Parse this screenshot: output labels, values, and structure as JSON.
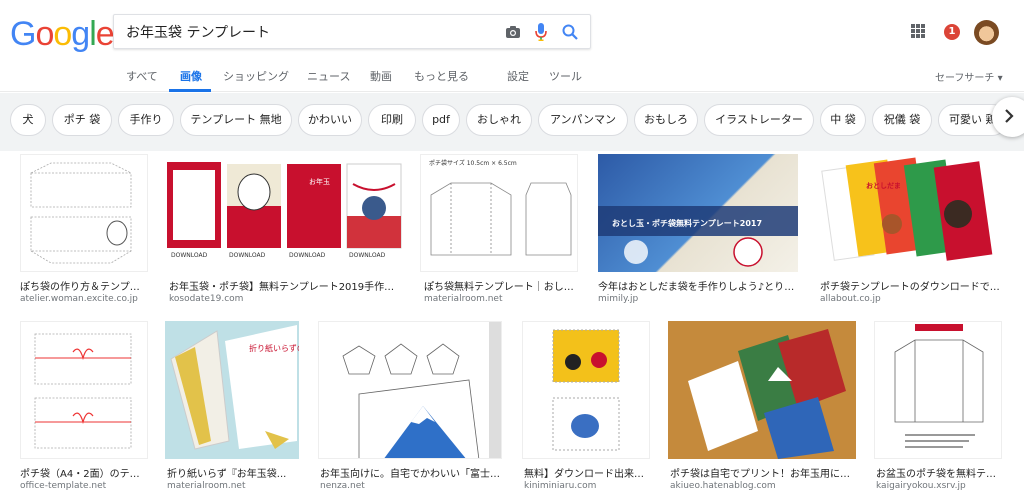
{
  "logo": {
    "text": "Google"
  },
  "search": {
    "query": "お年玉袋 テンプレート"
  },
  "icons": {
    "camera": "camera-icon",
    "mic": "mic-icon",
    "search": "search-icon",
    "apps": "apps-grid-icon",
    "next": "chevron-right-icon"
  },
  "notifications": {
    "count": "1"
  },
  "tabs": [
    {
      "label": "すべて"
    },
    {
      "label": "画像"
    },
    {
      "label": "ショッピング"
    },
    {
      "label": "ニュース"
    },
    {
      "label": "動画"
    },
    {
      "label": "もっと見る"
    },
    {
      "label": "設定"
    },
    {
      "label": "ツール"
    }
  ],
  "safesearch": {
    "label": "セーフサーチ ▾"
  },
  "chips": [
    {
      "label": "犬"
    },
    {
      "label": "ポチ 袋"
    },
    {
      "label": "手作り"
    },
    {
      "label": "テンプレート 無地"
    },
    {
      "label": "かわいい"
    },
    {
      "label": "印刷"
    },
    {
      "label": "pdf"
    },
    {
      "label": "おしゃれ"
    },
    {
      "label": "アンパンマン"
    },
    {
      "label": "おもしろ"
    },
    {
      "label": "イラストレーター"
    },
    {
      "label": "中 袋"
    },
    {
      "label": "祝儀 袋"
    },
    {
      "label": "可愛い 鶏"
    }
  ],
  "results": [
    {
      "caption": "ぽち袋の作り方＆テンプレ...",
      "domain": "atelier.woman.excite.co.jp"
    },
    {
      "caption": "お年玉袋・ポチ袋】無料テンプレート2019手作りで...",
      "domain": "kosodate19.com",
      "thumb_labels": [
        "DOWNLOAD",
        "DOWNLOAD",
        "DOWNLOAD",
        "DOWNLOAD"
      ],
      "thumb_text": "お年玉"
    },
    {
      "caption": "ぽち袋無料テンプレート｜おしゃ...",
      "domain": "materialroom.net",
      "thumb_title": "ポチ袋サイズ 10.5cm × 6.5cm"
    },
    {
      "caption": "今年はおとしだま袋を手作りしよう♪とりの...",
      "domain": "mimily.jp",
      "thumb_title": "おとし玉・ポチ袋無料テンプレート2017"
    },
    {
      "caption": "ポチ袋テンプレートのダウンロードでお...",
      "domain": "allabout.co.jp",
      "thumb_text": "おとしだま"
    },
    {
      "caption": "ポチ袋（A4・2面）のテン...",
      "domain": "office-template.net"
    },
    {
      "caption": "折り紙いらず『お年玉袋...",
      "domain": "materialroom.net",
      "thumb_title": "折り紙いらずの「おとしだま袋」"
    },
    {
      "caption": "お年玉向けに。自宅でかわいい「富士山...",
      "domain": "nenza.net"
    },
    {
      "caption": "無料】ダウンロード出来る...",
      "domain": "kiniminiaru.com"
    },
    {
      "caption": "ポチ袋は自宅でプリント！お年玉用にオ...",
      "domain": "akiueo.hatenablog.com"
    },
    {
      "caption": "お盆玉のポチ袋を無料テンプ...",
      "domain": "kaigairyokou.xsrv.jp"
    }
  ],
  "colors": {
    "accent": "#1a73e8",
    "notification": "#db4437",
    "chip_bg": "#f1f3f4"
  }
}
